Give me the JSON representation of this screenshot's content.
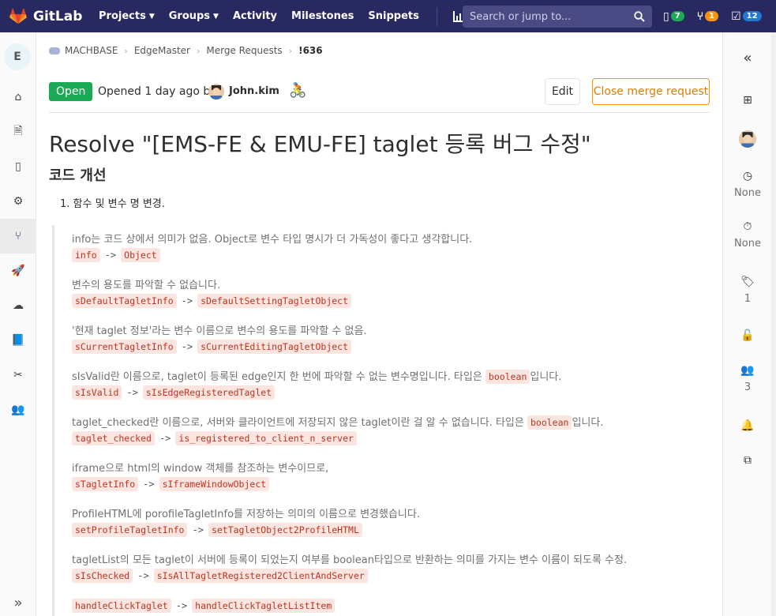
{
  "navbar": {
    "brand": "GitLab",
    "links": [
      {
        "label": "Projects",
        "dropdown": true
      },
      {
        "label": "Groups",
        "dropdown": true
      },
      {
        "label": "Activity",
        "dropdown": false
      },
      {
        "label": "Milestones",
        "dropdown": false
      },
      {
        "label": "Snippets",
        "dropdown": false
      }
    ],
    "search_placeholder": "Search or jump to...",
    "counters": {
      "issues": "7",
      "merge_requests": "1",
      "todos": "12"
    },
    "colors": {
      "background": "#292961",
      "green": "#1aaa55",
      "orange": "#fc9403",
      "blue": "#1f78d1"
    }
  },
  "project_avatar_letter": "E",
  "breadcrumb": [
    "MACHBASE",
    "EdgeMaster",
    "Merge Requests",
    "!636"
  ],
  "mr": {
    "status": "Open",
    "opened_prefix": "Opened",
    "opened_time": "1 day ago",
    "opened_by": "by",
    "author": "John.kim",
    "edit_label": "Edit",
    "close_label": "Close merge request",
    "title": "Resolve \"[EMS-FE & EMU-FE] taglet 등록 버그 수정\"",
    "subheading": "코드 개선",
    "list_item": "1. 함수 및 변수 명 변경.",
    "entries": [
      {
        "text": "info는 코드 상에서 의미가 없음. Object로 변수 타입 명시가 더 가독성이 좋다고 생각합니다.",
        "from": "info",
        "to": "Object"
      },
      {
        "text": "변수의 용도를 파악할 수 없습니다.",
        "from": "sDefaultTagletInfo",
        "to": "sDefaultSettingTagletObject"
      },
      {
        "text": "'현재 taglet 정보'라는 변수 이름으로 변수의 용도를 파악할 수 없음.",
        "from": "sCurrentTagletInfo",
        "to": "sCurrentEditingTagletObject"
      },
      {
        "text_a": "sIsValid란 이름으로, taglet이 등록된 edge인지 한 번에 파악할 수 없는 변수명입니다. 타입은 ",
        "inline": "boolean",
        "text_b": "입니다.",
        "from": "sIsValid",
        "to": "sIsEdgeRegisteredTaglet"
      },
      {
        "text_a": "taglet_checked란 이름으로, 서버와 클라이언트에 저장되지 않은 taglet이란 걸 알 수 없습니다. 타입은 ",
        "inline": "boolean",
        "text_b": "입니다.",
        "from": "taglet_checked",
        "to": "is_registered_to_client_n_server"
      },
      {
        "text": "iframe으로 html의 window 객체를 참조하는 변수이므로,",
        "from": "sTagletInfo",
        "to": "sIframeWindowObject"
      },
      {
        "text": "ProfileHTML에 porofileTagletInfo를 저장하는 의미의 이름으로 변경했습니다.",
        "from": "setProfileTagletInfo",
        "to": "setTagletObject2ProfileHTML"
      },
      {
        "text": "tagletList의 모든 taglet이 서버에 등록이 되었는지 여부를 boolean타입으로 반환하는 의미를 가지는 변수 이름이 되도록 수정.",
        "from": "sIsChecked",
        "to": "sIsAllTagletRegistered2ClientAndServer"
      }
    ],
    "last_from": "handleClickTaglet",
    "last_to": "handleClickTagletListItem",
    "arrow": "->"
  },
  "right_sidebar": {
    "milestone_value": "None",
    "time_value": "None",
    "labels_count": "1",
    "participants_count": "3"
  }
}
